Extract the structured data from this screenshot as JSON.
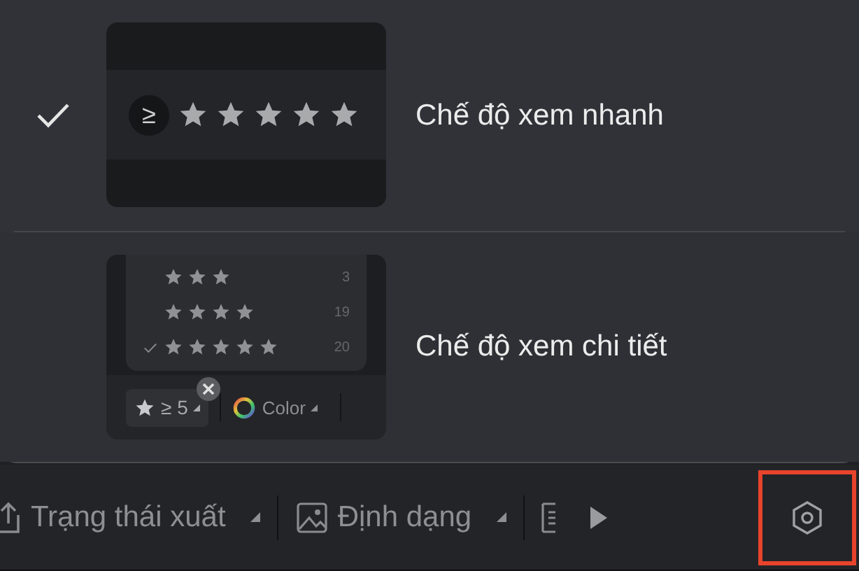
{
  "menu": {
    "items": [
      {
        "kind": "compact",
        "label": "Chế độ xem nhanh",
        "selected": true,
        "preview": {
          "operator": "≥",
          "stars": 5
        }
      },
      {
        "kind": "detailed",
        "label": "Chế độ xem chi tiết",
        "selected": false,
        "preview": {
          "rows": [
            {
              "stars": 3,
              "count": "3",
              "checked": false
            },
            {
              "stars": 4,
              "count": "19",
              "checked": false
            },
            {
              "stars": 5,
              "count": "20",
              "checked": true
            }
          ],
          "chip": "≥ 5",
          "color_label": "Color"
        }
      }
    ]
  },
  "toolbar": {
    "items": [
      {
        "kind": "export",
        "label": "Trạng thái xuất"
      },
      {
        "kind": "format",
        "label": "Định dạng"
      },
      {
        "kind": "cut"
      }
    ],
    "settings_button": {
      "highlighted": true
    }
  }
}
